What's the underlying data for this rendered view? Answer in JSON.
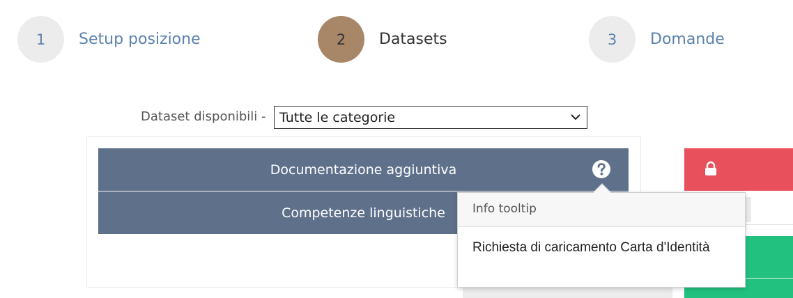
{
  "wizard": {
    "steps": [
      {
        "number": "1",
        "label": "Setup posizione",
        "active": false
      },
      {
        "number": "2",
        "label": "Datasets",
        "active": true
      },
      {
        "number": "3",
        "label": "Domande",
        "active": false
      }
    ]
  },
  "filter": {
    "label": "Dataset disponibili -",
    "selected": "Tutte le categorie"
  },
  "datasets": [
    {
      "label": "Documentazione aggiuntiva",
      "icon": "question-circle-icon"
    },
    {
      "label": "Competenze linguistiche"
    }
  ],
  "tooltip": {
    "title": "Info tooltip",
    "body": "Richiesta di caricamento Carta d'Identità"
  },
  "colors": {
    "active_step": "#a88769",
    "inactive_step_bg": "#ececec",
    "step_link": "#5b82ad",
    "dataset_item": "#5e708a",
    "locked_card": "#e8505b",
    "selected_card": "#22c17f"
  },
  "icons": {
    "lock": "lock-icon",
    "chevron": "chevron-down-icon"
  }
}
